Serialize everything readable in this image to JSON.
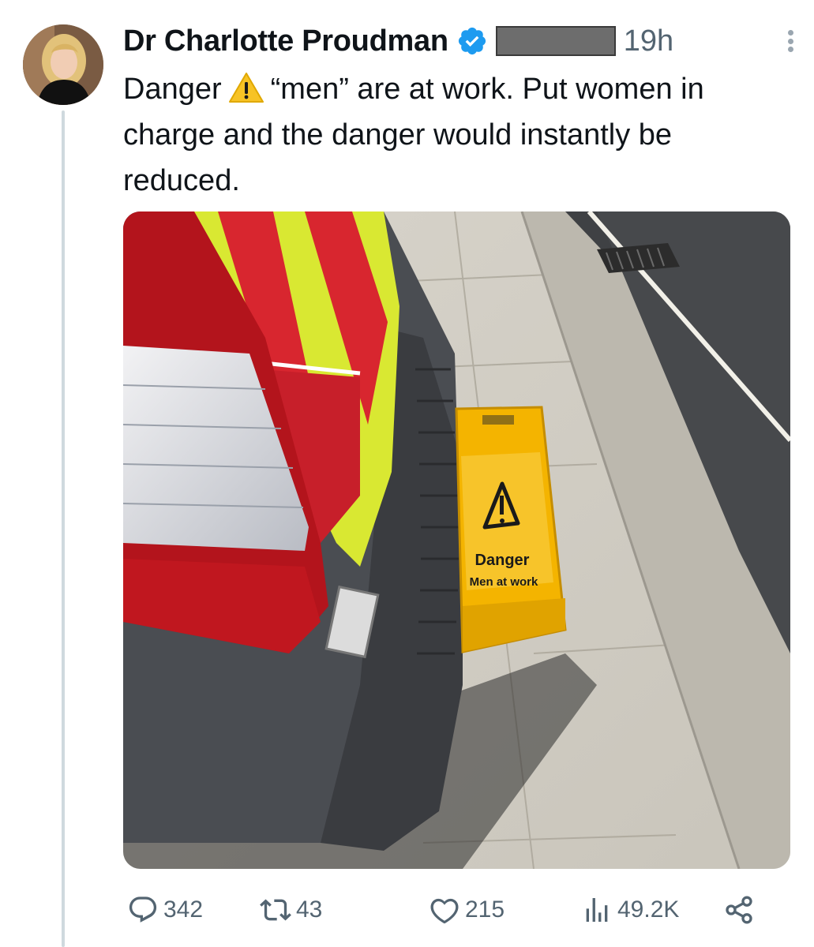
{
  "tweet": {
    "author": {
      "display_name": "Dr Charlotte Proudman",
      "verified": true,
      "avatar_icon": "avatar-photo"
    },
    "time": "19h",
    "text_before_emoji": "Danger",
    "emoji_icon": "warning-emoji-icon",
    "text_after_emoji": "“men” are at work. Put women in charge and the danger would instantly be reduced.",
    "media": {
      "sign_line1": "Danger",
      "sign_line2": "Men at work"
    },
    "actions": {
      "replies": "342",
      "reposts": "43",
      "likes": "215",
      "views": "49.2K"
    }
  },
  "colors": {
    "verified_blue": "#1d9bf0",
    "text_primary": "#0f1419",
    "text_secondary": "#536471",
    "thread_line": "#cfd9de",
    "sign_yellow": "#f4b400"
  }
}
